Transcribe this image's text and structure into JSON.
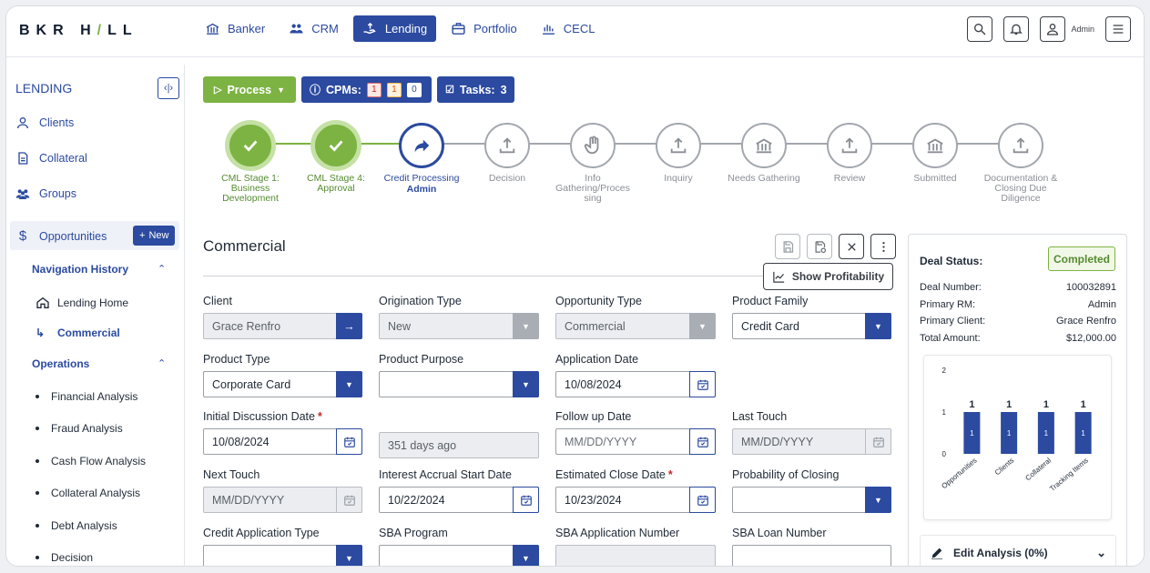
{
  "brand": {
    "logo_left": "BKR H",
    "logo_slash": "/",
    "logo_right": "LL"
  },
  "nav": [
    {
      "label": "Banker",
      "icon": "bank-icon"
    },
    {
      "label": "CRM",
      "icon": "people-icon"
    },
    {
      "label": "Lending",
      "icon": "lending-hand-icon",
      "active": true
    },
    {
      "label": "Portfolio",
      "icon": "briefcase-icon"
    },
    {
      "label": "CECL",
      "icon": "bar-chart-icon"
    }
  ],
  "user": {
    "name": "Admin"
  },
  "sidebar": {
    "title": "LENDING",
    "items": [
      {
        "label": "Clients",
        "icon": "user-icon"
      },
      {
        "label": "Collateral",
        "icon": "document-icon"
      },
      {
        "label": "Groups",
        "icon": "group-icon"
      },
      {
        "label": "Opportunities",
        "icon": "dollar-icon"
      }
    ],
    "new_label": "New",
    "nav_history": {
      "title": "Navigation History",
      "items": [
        {
          "label": "Lending Home"
        },
        {
          "label": "Commercial"
        }
      ]
    },
    "operations": {
      "title": "Operations",
      "items": [
        "Financial Analysis",
        "Fraud Analysis",
        "Cash Flow Analysis",
        "Collateral Analysis",
        "Debt Analysis",
        "Decision"
      ]
    }
  },
  "actions": {
    "process_label": "Process",
    "cpms_label": "CPMs:",
    "cpm_counts": [
      "1",
      "1",
      "0"
    ],
    "tasks_label": "Tasks:",
    "tasks_count": "3"
  },
  "steps": [
    {
      "label": "CML Stage 1: Business Development",
      "status": "done"
    },
    {
      "label": "CML Stage 4: Approval",
      "status": "done"
    },
    {
      "label": "Credit Processing",
      "sub": "Admin",
      "status": "current"
    },
    {
      "label": "Decision",
      "status": "todo"
    },
    {
      "label": "Info Gathering/Proces sing",
      "status": "todo"
    },
    {
      "label": "Inquiry",
      "status": "todo"
    },
    {
      "label": "Needs Gathering",
      "status": "todo"
    },
    {
      "label": "Review",
      "status": "todo"
    },
    {
      "label": "Submitted",
      "status": "todo"
    },
    {
      "label": "Documentation & Closing Due Diligence",
      "status": "todo"
    }
  ],
  "form": {
    "title": "Commercial",
    "profitability_label": "Show Profitability",
    "fields": {
      "client": {
        "label": "Client",
        "value": "Grace Renfro"
      },
      "origination_type": {
        "label": "Origination Type",
        "value": "New"
      },
      "opportunity_type": {
        "label": "Opportunity Type",
        "value": "Commercial"
      },
      "product_family": {
        "label": "Product Family",
        "value": "Credit Card"
      },
      "product_type": {
        "label": "Product Type",
        "value": "Corporate Card"
      },
      "product_purpose": {
        "label": "Product Purpose",
        "value": ""
      },
      "application_date": {
        "label": "Application Date",
        "value": "10/08/2024"
      },
      "initial_discussion_date": {
        "label": "Initial Discussion Date",
        "value": "10/08/2024"
      },
      "days_ago": {
        "value": "351 days ago"
      },
      "follow_up_date": {
        "label": "Follow up Date",
        "placeholder": "MM/DD/YYYY"
      },
      "last_touch": {
        "label": "Last Touch",
        "placeholder": "MM/DD/YYYY"
      },
      "next_touch": {
        "label": "Next Touch",
        "placeholder": "MM/DD/YYYY"
      },
      "interest_accrual_start_date": {
        "label": "Interest Accrual Start Date",
        "value": "10/22/2024"
      },
      "estimated_close_date": {
        "label": "Estimated Close Date",
        "value": "10/23/2024"
      },
      "probability_of_closing": {
        "label": "Probability of Closing",
        "value": ""
      },
      "credit_application_type": {
        "label": "Credit Application Type"
      },
      "sba_program": {
        "label": "SBA Program"
      },
      "sba_application_number": {
        "label": "SBA Application Number"
      },
      "sba_loan_number": {
        "label": "SBA Loan Number"
      }
    }
  },
  "deal_status": {
    "title": "Deal Status:",
    "status": "Completed",
    "rows": [
      {
        "key": "Deal Number:",
        "value": "100032891"
      },
      {
        "key": "Primary RM:",
        "value": "Admin"
      },
      {
        "key": "Primary Client:",
        "value": "Grace Renfro"
      },
      {
        "key": "Total Amount:",
        "value": "$12,000.00"
      }
    ],
    "edit_analysis_label": "Edit Analysis (0%)"
  },
  "chart_data": {
    "type": "bar",
    "categories": [
      "Opportunities",
      "Clients",
      "Collateral",
      "Tracking Items"
    ],
    "values": [
      1,
      1,
      1,
      1
    ],
    "ylim": [
      0,
      2
    ],
    "yticks": [
      "2",
      "1",
      "0"
    ],
    "color": "#2b4aa0"
  },
  "colors": {
    "primary": "#2b4aa0",
    "success": "#7cb342",
    "required": "#c62828"
  }
}
